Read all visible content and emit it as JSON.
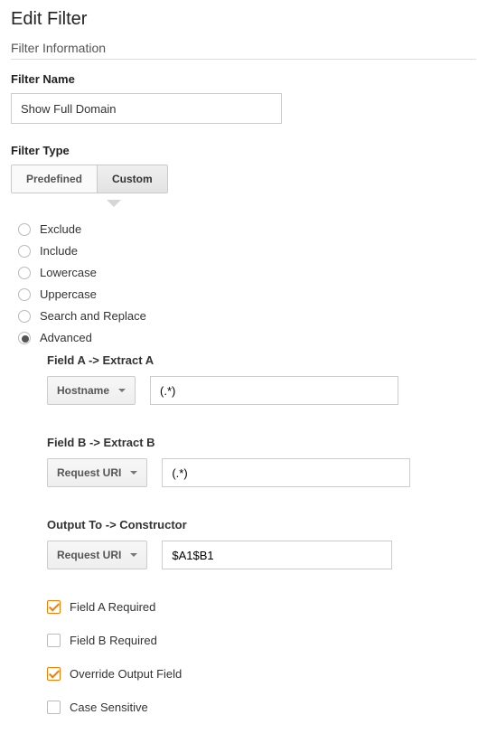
{
  "page_title": "Edit Filter",
  "section_title": "Filter Information",
  "filter_name": {
    "label": "Filter Name",
    "value": "Show Full Domain"
  },
  "filter_type": {
    "label": "Filter Type",
    "tabs": {
      "predefined": "Predefined",
      "custom": "Custom"
    },
    "active_tab": "custom",
    "options": [
      {
        "label": "Exclude"
      },
      {
        "label": "Include"
      },
      {
        "label": "Lowercase"
      },
      {
        "label": "Uppercase"
      },
      {
        "label": "Search and Replace"
      },
      {
        "label": "Advanced"
      }
    ],
    "selected_option": "Advanced"
  },
  "advanced": {
    "field_a": {
      "title": "Field A -> Extract A",
      "select": "Hostname",
      "value": "(.*)"
    },
    "field_b": {
      "title": "Field B -> Extract B",
      "select": "Request URI",
      "value": "(.*)"
    },
    "output": {
      "title": "Output To -> Constructor",
      "select": "Request URI",
      "value": "$A1$B1"
    },
    "checks": {
      "field_a_required": {
        "label": "Field A Required",
        "checked": true
      },
      "field_b_required": {
        "label": "Field B Required",
        "checked": false
      },
      "override_output": {
        "label": "Override Output Field",
        "checked": true
      },
      "case_sensitive": {
        "label": "Case Sensitive",
        "checked": false
      }
    }
  }
}
